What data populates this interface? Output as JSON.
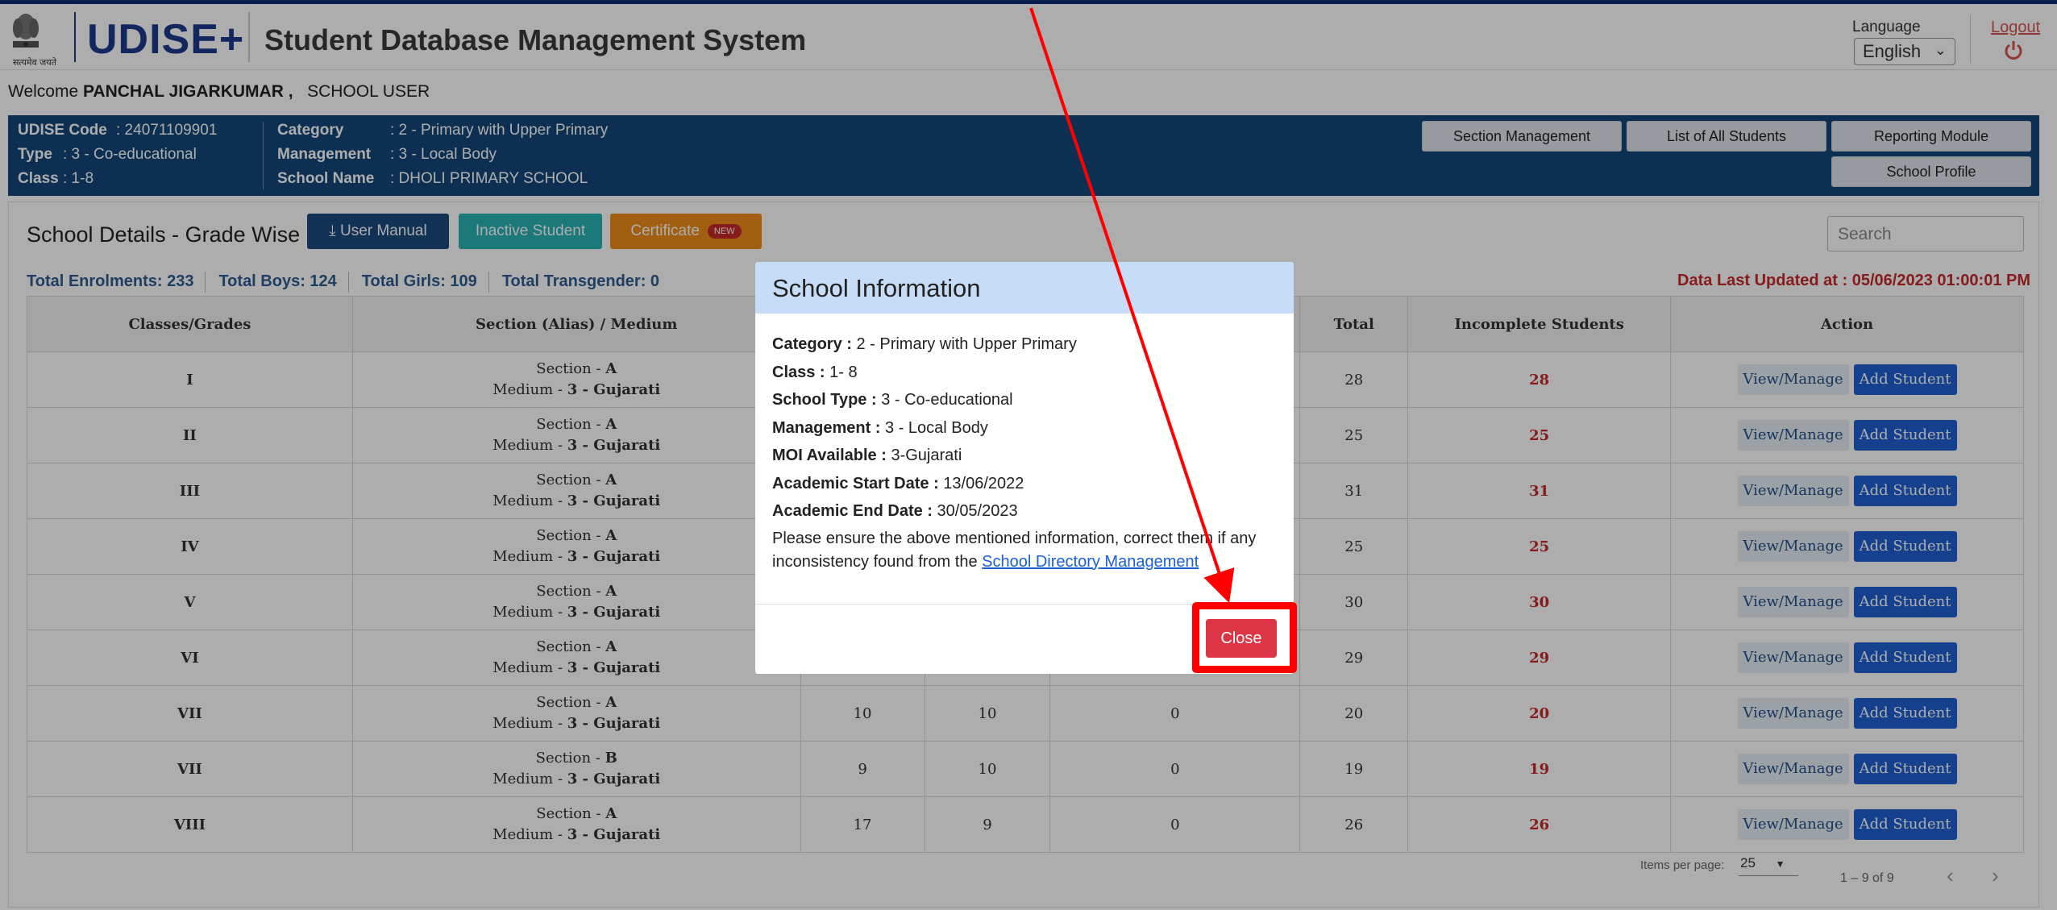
{
  "header": {
    "motto": "सत्यमेव जयते",
    "brand": "UDISE",
    "brand_plus": "+",
    "system_title": "Student Database Management System",
    "language_label": "Language",
    "language_value": "English",
    "logout": "Logout"
  },
  "welcome": {
    "prefix": "Welcome",
    "name": "PANCHAL JIGARKUMAR ,",
    "role": "SCHOOL USER"
  },
  "school": {
    "udise_label": "UDISE Code",
    "udise_value": ": 24071109901",
    "type_label": "Type",
    "type_value": ": 3 - Co-educational",
    "class_label": "Class",
    "class_value": ": 1-8",
    "category_label": "Category",
    "category_value": ": 2 - Primary with Upper Primary",
    "management_label": "Management",
    "management_value": ": 3 - Local Body",
    "name_label": "School Name",
    "name_value": ": DHOLI PRIMARY SCHOOL"
  },
  "top_buttons": {
    "section_management": "Section Management",
    "list_students": "List of All Students",
    "reporting": "Reporting Module",
    "profile": "School Profile"
  },
  "main": {
    "title": "School Details - Grade Wise",
    "user_manual": "User Manual",
    "inactive_student": "Inactive Student",
    "certificate": "Certificate",
    "new_badge": "NEW",
    "search_placeholder": "Search",
    "total_enrolments": "Total Enrolments: 233",
    "total_boys": "Total Boys: 124",
    "total_girls": "Total Girls: 109",
    "total_transgender": "Total Transgender: 0",
    "last_updated": "Data Last Updated at : 05/06/2023 01:00:01 PM"
  },
  "table": {
    "headers": [
      "Classes/Grades",
      "Section (Alias) / Medium",
      "",
      "",
      "",
      "Total",
      "Incomplete Students",
      "Action"
    ],
    "section_prefix": "Section - ",
    "medium_prefix": "Medium - ",
    "view_label": "View/Manage",
    "add_label": "Add Student",
    "rows": [
      {
        "grade": "I",
        "section": "A",
        "medium": "3 - Gujarati",
        "boys": "",
        "girls": "",
        "trans": "",
        "total": "28",
        "incomplete": "28"
      },
      {
        "grade": "II",
        "section": "A",
        "medium": "3 - Gujarati",
        "boys": "",
        "girls": "",
        "trans": "",
        "total": "25",
        "incomplete": "25"
      },
      {
        "grade": "III",
        "section": "A",
        "medium": "3 - Gujarati",
        "boys": "",
        "girls": "",
        "trans": "",
        "total": "31",
        "incomplete": "31"
      },
      {
        "grade": "IV",
        "section": "A",
        "medium": "3 - Gujarati",
        "boys": "",
        "girls": "",
        "trans": "",
        "total": "25",
        "incomplete": "25"
      },
      {
        "grade": "V",
        "section": "A",
        "medium": "3 - Gujarati",
        "boys": "",
        "girls": "",
        "trans": "",
        "total": "30",
        "incomplete": "30"
      },
      {
        "grade": "VI",
        "section": "A",
        "medium": "3 - Gujarati",
        "boys": "",
        "girls": "",
        "trans": "",
        "total": "29",
        "incomplete": "29"
      },
      {
        "grade": "VII",
        "section": "A",
        "medium": "3 - Gujarati",
        "boys": "10",
        "girls": "10",
        "trans": "0",
        "total": "20",
        "incomplete": "20"
      },
      {
        "grade": "VII",
        "section": "B",
        "medium": "3 - Gujarati",
        "boys": "9",
        "girls": "10",
        "trans": "0",
        "total": "19",
        "incomplete": "19"
      },
      {
        "grade": "VIII",
        "section": "A",
        "medium": "3 - Gujarati",
        "boys": "17",
        "girls": "9",
        "trans": "0",
        "total": "26",
        "incomplete": "26"
      }
    ]
  },
  "pager": {
    "items_per_page_label": "Items per page:",
    "items_per_page_value": "25",
    "range": "1 – 9 of 9"
  },
  "modal": {
    "title": "School Information",
    "category_label": "Category :",
    "category_value": " 2 - Primary with Upper Primary",
    "class_label": "Class :",
    "class_value": " 1- 8",
    "school_type_label": "School Type :",
    "school_type_value": " 3 - Co-educational",
    "management_label": "Management :",
    "management_value": " 3 - Local Body",
    "moi_label": "MOI Available :",
    "moi_value": " 3-Gujarati",
    "start_label": "Academic Start Date :",
    "start_value": " 13/06/2022",
    "end_label": "Academic End Date :",
    "end_value": " 30/05/2023",
    "note": "Please ensure the above mentioned information, correct them if any inconsistency found from the ",
    "link": "School Directory Management",
    "close": "Close"
  },
  "colors": {
    "brand_blue": "#1b3a8a",
    "info_bar": "#14487a",
    "modal_header": "#c7dcf7",
    "close_red": "#dc3545",
    "annotation_red": "#ff0000"
  }
}
